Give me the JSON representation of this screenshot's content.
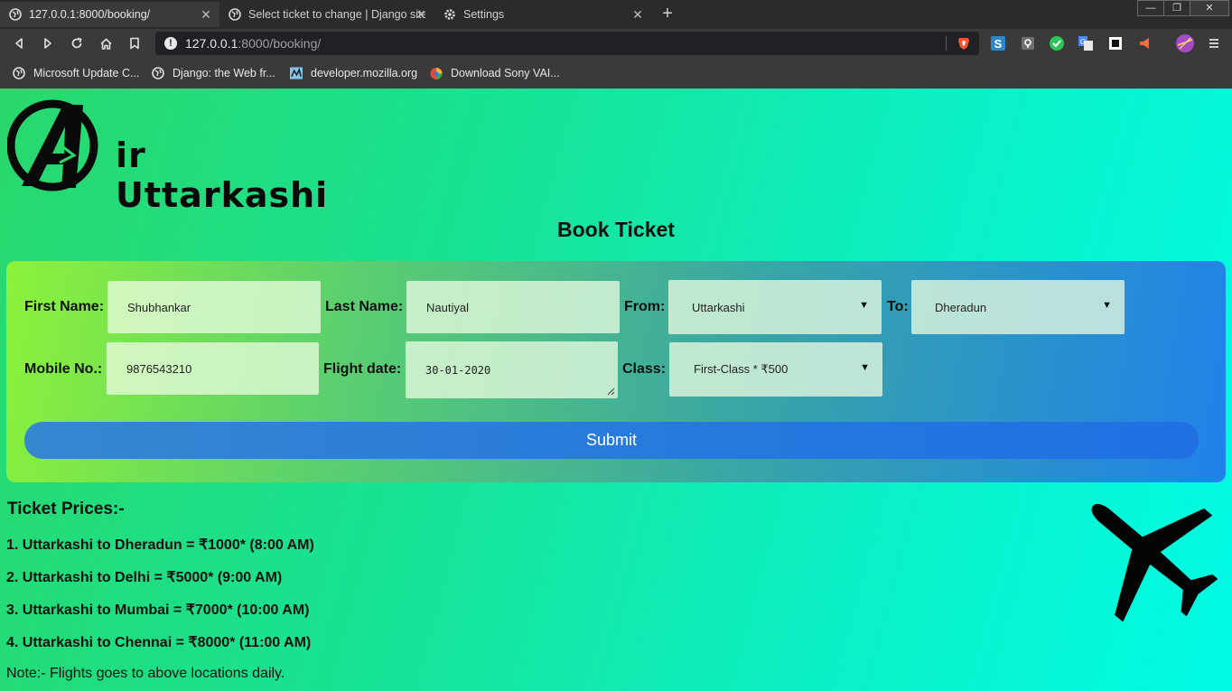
{
  "browser": {
    "tabs": [
      {
        "title": "127.0.0.1:8000/booking/",
        "active": true,
        "icon": "globe-icon"
      },
      {
        "title": "Select ticket to change | Django site admin",
        "active": false,
        "icon": "globe-icon"
      },
      {
        "title": "Settings",
        "active": false,
        "icon": "gear-icon"
      }
    ],
    "url_host": "127.0.0.1",
    "url_rest": ":8000/booking/",
    "bookmarks": [
      {
        "label": "Microsoft Update C...",
        "icon": "globe-icon"
      },
      {
        "label": "Django: the Web fr...",
        "icon": "globe-icon"
      },
      {
        "label": "developer.mozilla.org",
        "icon": "mdn-icon"
      },
      {
        "label": "Download Sony VAI...",
        "icon": "sony-icon"
      }
    ]
  },
  "brand": {
    "logo_text": "ir Uttarkashi"
  },
  "page": {
    "title": "Book Ticket"
  },
  "form": {
    "first_name_label": "First Name:",
    "first_name_value": "Shubhankar",
    "last_name_label": "Last Name:",
    "last_name_value": "Nautiyal",
    "from_label": "From:",
    "from_value": "Uttarkashi",
    "to_label": "To:",
    "to_value": "Dheradun",
    "mobile_label": "Mobile No.:",
    "mobile_value": "9876543210",
    "date_label": "Flight date:",
    "date_value": "30-01-2020",
    "class_label": "Class:",
    "class_value": "First-Class * ₹500",
    "submit_label": "Submit"
  },
  "prices": {
    "title": "Ticket Prices:-",
    "items": [
      "1. Uttarkashi to Dheradun = ₹1000* (8:00 AM)",
      "2. Uttarkashi to Delhi = ₹5000* (9:00 AM)",
      "3. Uttarkashi to Mumbai = ₹7000* (10:00 AM)",
      "4. Uttarkashi to Chennai = ₹8000* (11:00 AM)"
    ],
    "note": "Note:- Flights goes to above locations daily."
  },
  "colors": {
    "page_gradient_start": "#29d86c",
    "page_gradient_end": "#00fbe5",
    "submit": "#2678de"
  }
}
